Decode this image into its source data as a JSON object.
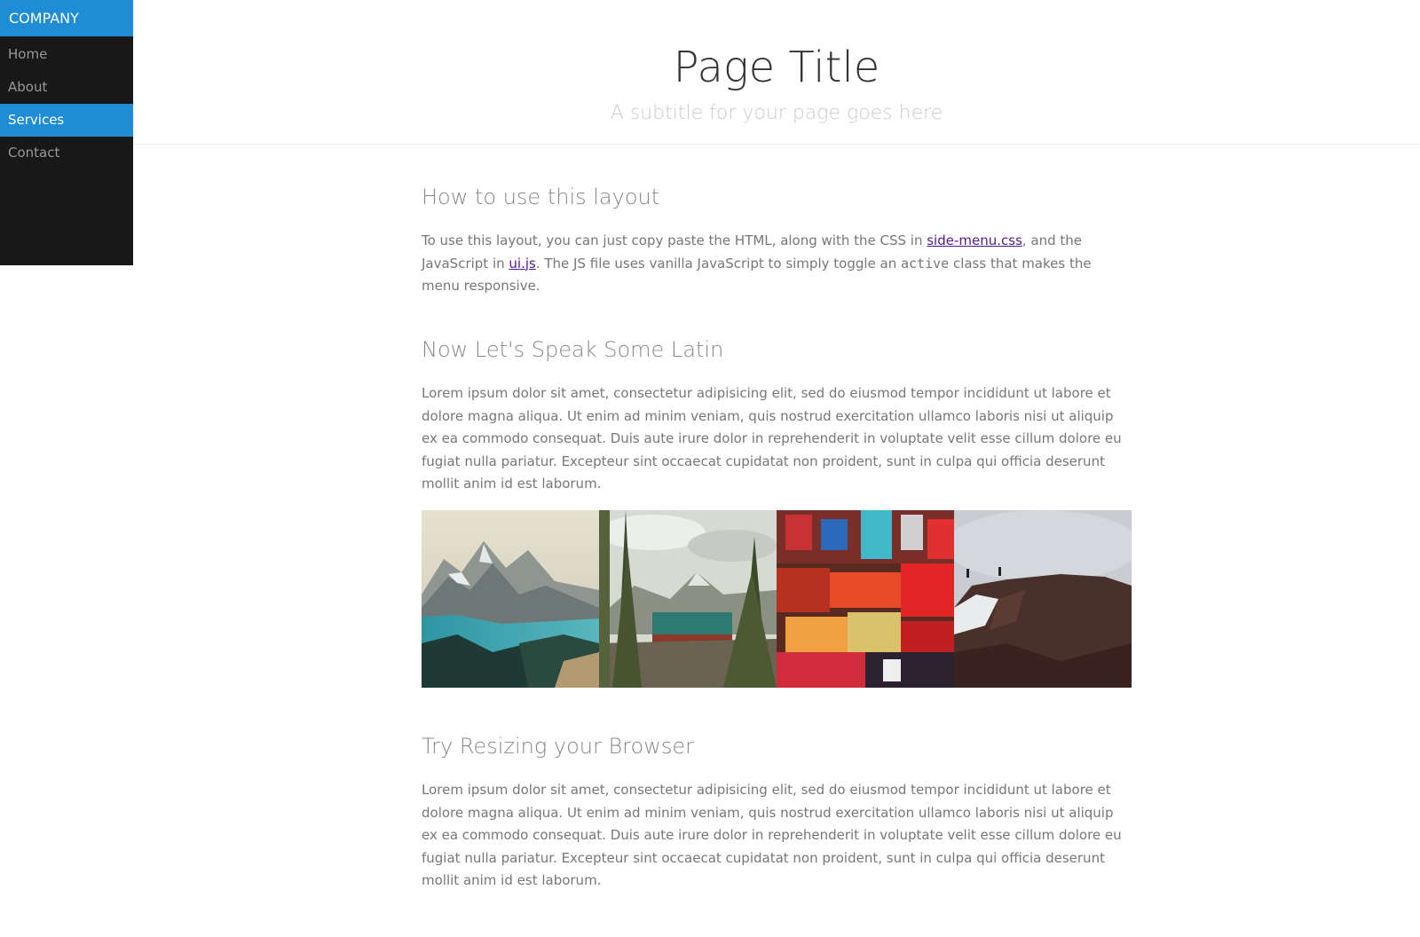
{
  "sidebar": {
    "brand": "COMPANY",
    "items": [
      {
        "label": "Home"
      },
      {
        "label": "About"
      },
      {
        "label": "Services"
      },
      {
        "label": "Contact"
      }
    ],
    "selected": "Services"
  },
  "header": {
    "title": "Page Title",
    "subtitle": "A subtitle for your page goes here"
  },
  "sections": [
    {
      "heading": "How to use this layout",
      "text_1": "To use this layout, you can just copy paste the HTML, along with the CSS in ",
      "link_1": "side-menu.css",
      "text_2": ", and the JavaScript in ",
      "link_2": "ui.js",
      "text_3": ". The JS file uses vanilla JavaScript to simply toggle an ",
      "code": "active",
      "text_4": " class that makes the menu responsive."
    },
    {
      "heading": "Now Let's Speak Some Latin",
      "text": "Lorem ipsum dolor sit amet, consectetur adipisicing elit, sed do eiusmod tempor incididunt ut labore et dolore magna aliqua. Ut enim ad minim veniam, quis nostrud exercitation ullamco laboris nisi ut aliquip ex ea commodo consequat. Duis aute irure dolor in reprehenderit in voluptate velit esse cillum dolore eu fugiat nulla pariatur. Excepteur sint occaecat cupidatat non proident, sunt in culpa qui officia deserunt mollit anim id est laborum."
    },
    {
      "heading": "Try Resizing your Browser",
      "text": "Lorem ipsum dolor sit amet, consectetur adipisicing elit, sed do eiusmod tempor incididunt ut labore et dolore magna aliqua. Ut enim ad minim veniam, quis nostrud exercitation ullamco laboris nisi ut aliquip ex ea commodo consequat. Duis aute irure dolor in reprehenderit in voluptate velit esse cillum dolore eu fugiat nulla pariatur. Excepteur sint occaecat cupidatat non proident, sunt in culpa qui officia deserunt mollit anim id est laborum."
    }
  ],
  "photos": [
    {
      "subject": "mountain-lake-photo"
    },
    {
      "subject": "forest-mountain-photo"
    },
    {
      "subject": "clothing-store-photo"
    },
    {
      "subject": "cliff-hikers-photo"
    }
  ],
  "colors": {
    "accent": "#1f8dd6",
    "sidebar_bg": "#191818",
    "link": "#551a8b"
  }
}
